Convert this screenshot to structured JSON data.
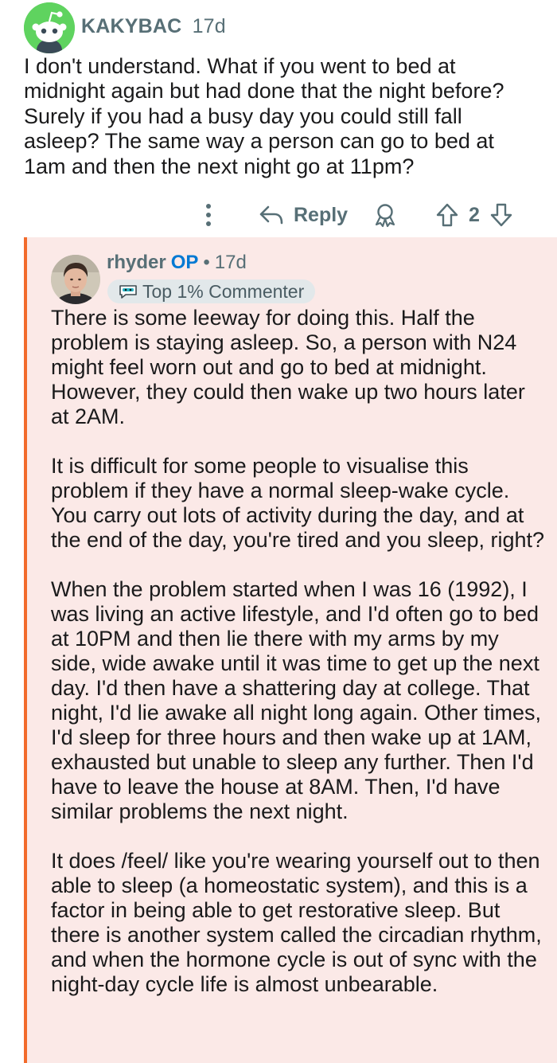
{
  "top_comment": {
    "username": "KAKYBAC",
    "age": "17d",
    "body": "I don't understand. What if you went to bed at midnight again but had done that the night before? Surely if you had a busy day you could still fall asleep? The same way a person can go to bed at 1am and then the next night go at 11pm?",
    "actions": {
      "reply_label": "Reply",
      "vote_count": "2"
    }
  },
  "reply_comment": {
    "username": "rhyder",
    "op_tag": "OP",
    "separator": "•",
    "age": "17d",
    "badge": "Top 1% Commenter",
    "paragraphs": [
      "There is some leeway for doing this. Half the problem is staying asleep. So, a person with N24 might feel worn out and go to bed at midnight. However, they could then wake up two hours later at 2AM.",
      "It is difficult for some people to visualise this problem if they have a normal sleep-wake cycle. You carry out lots of activity during the day, and at the end of the day, you're tired and you sleep, right?",
      "When the problem started when I was 16 (1992), I was living an active lifestyle, and I'd often go to bed at 10PM and then lie there with my arms by my side, wide awake until it was time to get up the next day. I'd then have a shattering day at college. That night, I'd lie awake all night long again. Other times, I'd sleep for three hours and then wake up at 1AM, exhausted but unable to sleep any further. Then I'd have to leave the house at 8AM. Then, I'd have similar problems the next night.",
      "It does /feel/ like you're wearing yourself out to then able to sleep (a homeostatic system), and this is a factor in being able to get restorative sleep. But there is another system called the circadian rhythm, and when the hormone cycle is out of sync with the night-day cycle life is almost unbearable."
    ]
  },
  "icons": {
    "more": "more-vertical-icon",
    "reply": "reply-arrow-icon",
    "award": "award-icon",
    "upvote": "upvote-icon",
    "downvote": "downvote-icon",
    "badge": "commenter-badge-icon"
  },
  "colors": {
    "op_accent": "#f26b2b",
    "op_tag": "#0079d3",
    "reply_background": "#fbe9e7",
    "meta_text": "#576f76",
    "snoo_avatar": "#5fd35f"
  }
}
